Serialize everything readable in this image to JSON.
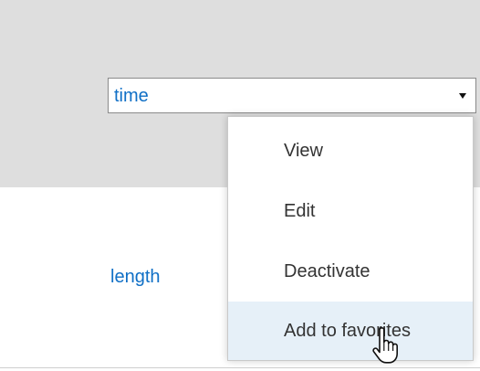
{
  "dropdown": {
    "value": "time"
  },
  "list": {
    "row_label": "length"
  },
  "context_menu": {
    "items": [
      {
        "label": "View"
      },
      {
        "label": "Edit"
      },
      {
        "label": "Deactivate"
      },
      {
        "label": "Add to favorites"
      }
    ],
    "hovered_item": "Add to favorites"
  },
  "icons": {
    "dropdown_arrow": "chevron-down-icon",
    "pointer": "hand-pointer-icon"
  },
  "colors": {
    "header_background": "#dedede",
    "link_text": "#0f6fc6",
    "menu_text": "#333333",
    "menu_hover_background": "#e6f0f8"
  }
}
